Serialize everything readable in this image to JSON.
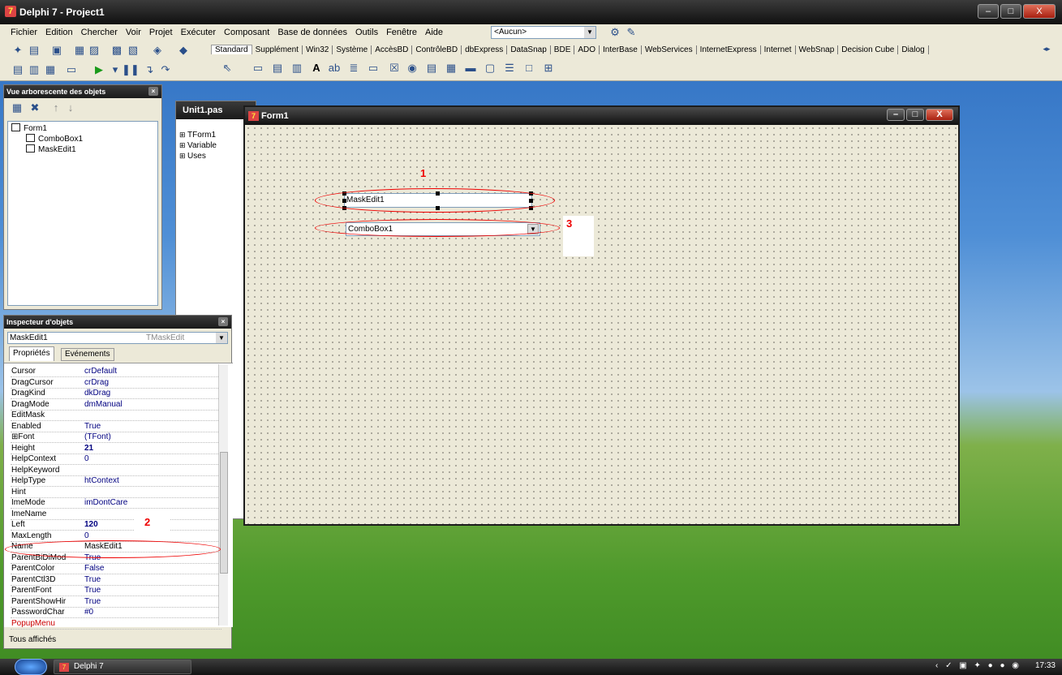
{
  "window": {
    "title": "Delphi 7 - Project1"
  },
  "menu": [
    "Fichier",
    "Edition",
    "Chercher",
    "Voir",
    "Projet",
    "Exécuter",
    "Composant",
    "Base de données",
    "Outils",
    "Fenêtre",
    "Aide"
  ],
  "toolbar": {
    "config_combo": "<Aucun>"
  },
  "palette_tabs": [
    "Standard",
    "Supplément",
    "Win32",
    "Système",
    "AccèsBD",
    "ContrôleBD",
    "dbExpress",
    "DataSnap",
    "BDE",
    "ADO",
    "InterBase",
    "WebServices",
    "InternetExpress",
    "Internet",
    "WebSnap",
    "Decision Cube",
    "Dialog"
  ],
  "object_tree": {
    "title": "Vue arborescente des objets",
    "nodes": [
      "Form1",
      "ComboBox1",
      "MaskEdit1"
    ]
  },
  "editor": {
    "tab": "Unit1.pas",
    "nodes": [
      "TForm1",
      "Variable",
      "Uses"
    ]
  },
  "inspector": {
    "title": "Inspecteur d'objets",
    "selected_object": "MaskEdit1",
    "selected_type": "TMaskEdit",
    "tabs": [
      "Propriétés",
      "Evénements"
    ],
    "footer": "Tous affichés",
    "properties": [
      {
        "name": "Cursor",
        "value": "crDefault"
      },
      {
        "name": "DragCursor",
        "value": "crDrag"
      },
      {
        "name": "DragKind",
        "value": "dkDrag"
      },
      {
        "name": "DragMode",
        "value": "dmManual"
      },
      {
        "name": "EditMask",
        "value": ""
      },
      {
        "name": "Enabled",
        "value": "True"
      },
      {
        "name": "⊞Font",
        "value": "(TFont)"
      },
      {
        "name": "Height",
        "value": "21",
        "bold": true
      },
      {
        "name": "HelpContext",
        "value": "0"
      },
      {
        "name": "HelpKeyword",
        "value": ""
      },
      {
        "name": "HelpType",
        "value": "htContext"
      },
      {
        "name": "Hint",
        "value": ""
      },
      {
        "name": "ImeMode",
        "value": "imDontCare"
      },
      {
        "name": "ImeName",
        "value": ""
      },
      {
        "name": "Left",
        "value": "120",
        "bold": true
      },
      {
        "name": "MaxLength",
        "value": "0"
      },
      {
        "name": "Name",
        "value": "MaskEdit1"
      },
      {
        "name": "ParentBiDiMod",
        "value": "True"
      },
      {
        "name": "ParentColor",
        "value": "False"
      },
      {
        "name": "ParentCtl3D",
        "value": "True"
      },
      {
        "name": "ParentFont",
        "value": "True"
      },
      {
        "name": "ParentShowHir",
        "value": "True"
      },
      {
        "name": "PasswordChar",
        "value": "#0"
      },
      {
        "name": "PopupMenu",
        "value": "",
        "red": true
      }
    ]
  },
  "form": {
    "title": "Form1",
    "maskedit_text": "MaskEdit1",
    "combobox_text": "ComboBox1"
  },
  "annotations": [
    "1",
    "2",
    "3"
  ],
  "taskbar": {
    "item": "Delphi 7",
    "clock": "17:33"
  }
}
